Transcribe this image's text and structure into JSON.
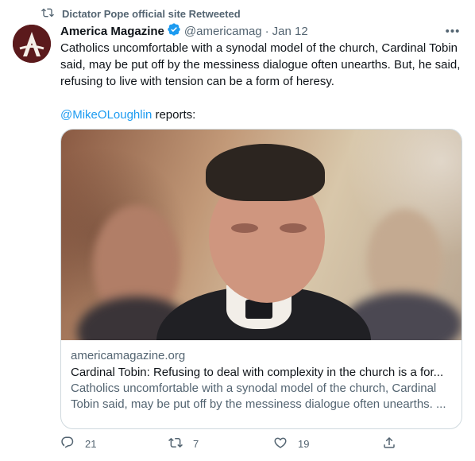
{
  "retweet_context": {
    "icon": "retweet-icon",
    "text": "Dictator Pope official site Retweeted"
  },
  "tweet": {
    "author_name": "America Magazine",
    "verified_icon": "verified-badge-icon",
    "handle": "@americamag",
    "separator": "·",
    "date": "Jan 12",
    "more_icon": "more-options-icon",
    "text_line1": "Catholics uncomfortable with a synodal model of the church, Cardinal Tobin said, may be put off by the messiness dialogue often unearths. But, he said, refusing to live with tension can be a form of heresy.",
    "mention": "@MikeOLoughlin",
    "text_after_mention": " reports:"
  },
  "link_card": {
    "domain": "americamagazine.org",
    "title": "Cardinal Tobin: Refusing to deal with complexity in the church is a for...",
    "description": "Catholics uncomfortable with a synodal model of the church, Cardinal Tobin said, may be put off by the messiness dialogue often unearths. ..."
  },
  "actions": {
    "reply": {
      "icon": "reply-icon",
      "count": "21"
    },
    "retweet": {
      "icon": "retweet-icon",
      "count": "7"
    },
    "like": {
      "icon": "heart-icon",
      "count": "19"
    },
    "share": {
      "icon": "share-icon"
    }
  },
  "colors": {
    "accent": "#1d9bf0",
    "secondary_text": "#536471",
    "border": "#cfd9de",
    "avatar_bg": "#5b1a1c"
  }
}
